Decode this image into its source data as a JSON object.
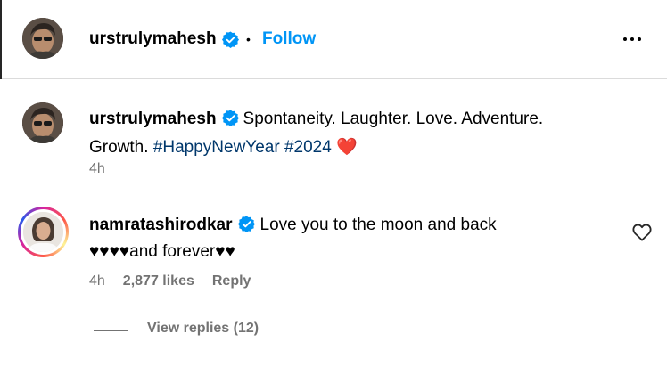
{
  "post": {
    "username": "urstrulymahesh",
    "separator": "•",
    "follow_label": "Follow"
  },
  "caption": {
    "username": "urstrulymahesh",
    "text_line1": "Spontaneity. Laughter. Love. Adventure.",
    "text_line2": "Growth.",
    "hashtag1": "#HappyNewYear",
    "hashtag2": "#2024",
    "heart": "❤️",
    "time": "4h"
  },
  "comment": {
    "username": "namratashirodkar",
    "text_line1": "Love you to the moon and back",
    "text_line2": "♥♥♥♥and forever♥♥",
    "time": "4h",
    "likes": "2,877 likes",
    "reply_label": "Reply",
    "view_replies": "View replies (12)"
  },
  "colors": {
    "accent": "#0095f6",
    "hashtag": "#00376b",
    "muted": "#737373",
    "verified": "#0095f6",
    "heart": "#ed4956"
  },
  "icons": [
    "verified-badge-icon",
    "more-options-icon",
    "like-heart-icon"
  ]
}
